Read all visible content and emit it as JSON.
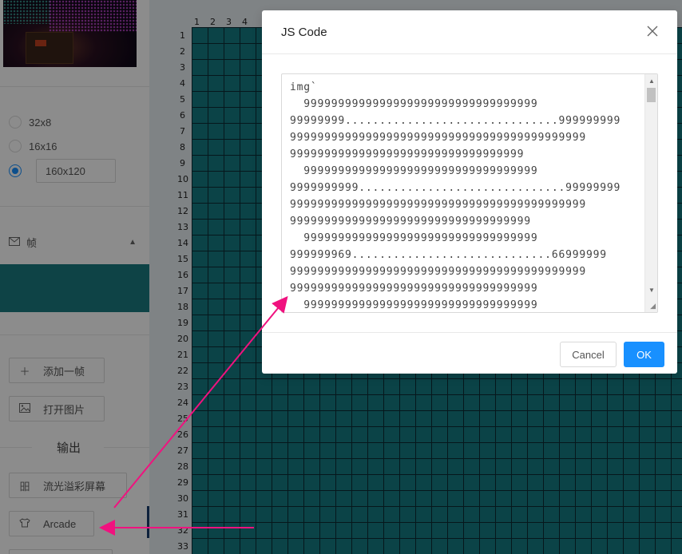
{
  "sidebar": {
    "size_options": [
      {
        "label": "32x8",
        "checked": false
      },
      {
        "label": "16x16",
        "checked": false
      },
      {
        "label": "",
        "checked": true
      }
    ],
    "custom_size_value": "160x120",
    "frame_section": {
      "icon": "mail-icon",
      "label": "帧",
      "chevron": "▲"
    },
    "add_frame_button": "添加一帧",
    "open_image_button": "打开图片",
    "output_title": "输出",
    "output_buttons": {
      "rainbow": "流光溢彩屏幕",
      "arcade": "Arcade"
    }
  },
  "canvas": {
    "column_numbers": [
      "1",
      "2",
      "3",
      "4"
    ],
    "row_numbers": [
      "1",
      "2",
      "3",
      "4",
      "5",
      "6",
      "7",
      "8",
      "9",
      "10",
      "11",
      "12",
      "13",
      "14",
      "15",
      "16",
      "17",
      "18",
      "19",
      "20",
      "21",
      "22",
      "23",
      "24",
      "25",
      "26",
      "27",
      "28",
      "29",
      "30",
      "31",
      "32",
      "33"
    ],
    "colors": {
      "cell": "#147a82",
      "grid_line": "#0b2a33"
    }
  },
  "modal": {
    "title": "JS Code",
    "close_icon": "close-icon",
    "code": "img`\n  9999999999999999999999999999999999\n99999999...............................999999999\n9999999999999999999999999999999999999999999\n9999999999999999999999999999999999\n  9999999999999999999999999999999999\n9999999999..............................99999999\n9999999999999999999999999999999999999999999\n99999999999999999999999999999999999\n  9999999999999999999999999999999999\n999999969.............................66999999\n9999999999999999999999999999999999999999999\n999999999999999999999999999999999999\n  9999999999999999999999999999999999",
    "cancel_label": "Cancel",
    "ok_label": "OK"
  },
  "annotation_color": "#f0127f"
}
